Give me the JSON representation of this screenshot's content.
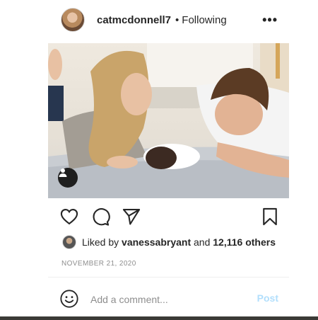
{
  "header": {
    "username": "catmcdonnell7",
    "separator": "•",
    "follow_status": "Following",
    "more_label": "•••"
  },
  "photo": {
    "alt": "Couple lying on a bed smiling at their newborn baby",
    "tag_icon": "user-tag-icon"
  },
  "actions": {
    "like_icon": "heart-icon",
    "comment_icon": "comment-icon",
    "share_icon": "paper-plane-icon",
    "save_icon": "bookmark-icon"
  },
  "likes": {
    "prefix": "Liked by ",
    "user": "vanessabryant",
    "middle": " and ",
    "count": "12,116 others"
  },
  "date": "NOVEMBER 21, 2020",
  "comment": {
    "placeholder": "Add a comment...",
    "post_label": "Post",
    "emoji_icon": "smiley-icon"
  },
  "colors": {
    "text": "#262626",
    "muted": "#8e8e8e",
    "post_disabled": "#b2dffc"
  }
}
